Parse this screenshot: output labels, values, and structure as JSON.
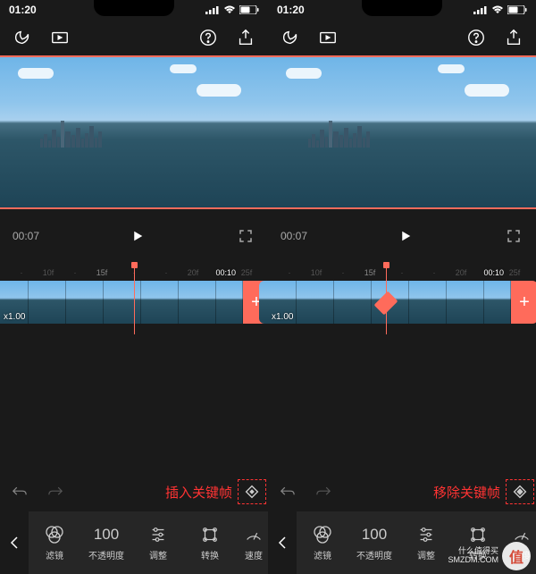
{
  "status": {
    "time": "01:20",
    "signal": 4,
    "wifi": true,
    "battery": 60
  },
  "top_icons": {
    "home": "home",
    "aspect": "aspect",
    "help": "?",
    "export": "export"
  },
  "preview": {
    "current_time": "00:07"
  },
  "ruler_ticks": [
    "10f",
    "15f",
    "20f",
    "25f"
  ],
  "clip": {
    "speed": "x1.00",
    "duration": "00:10",
    "add": "+"
  },
  "panels": [
    {
      "playhead_percent": 50,
      "has_keyframe_marker": false,
      "action_label": "插入关键帧"
    },
    {
      "playhead_percent": 44,
      "has_keyframe_marker": true,
      "action_label": "移除关键帧"
    }
  ],
  "action_row": {
    "undo": "↶",
    "redo": "↷"
  },
  "tools": [
    {
      "label": "滤镜",
      "icon": "filters"
    },
    {
      "label": "不透明度",
      "icon": "opacity",
      "value": "100"
    },
    {
      "label": "调整",
      "icon": "adjust"
    },
    {
      "label": "转换",
      "icon": "transform"
    },
    {
      "label": "速度",
      "icon": "speed"
    }
  ],
  "watermark": {
    "line1": "什么值得买",
    "line2": "SMZDM.COM",
    "badge": "值"
  }
}
